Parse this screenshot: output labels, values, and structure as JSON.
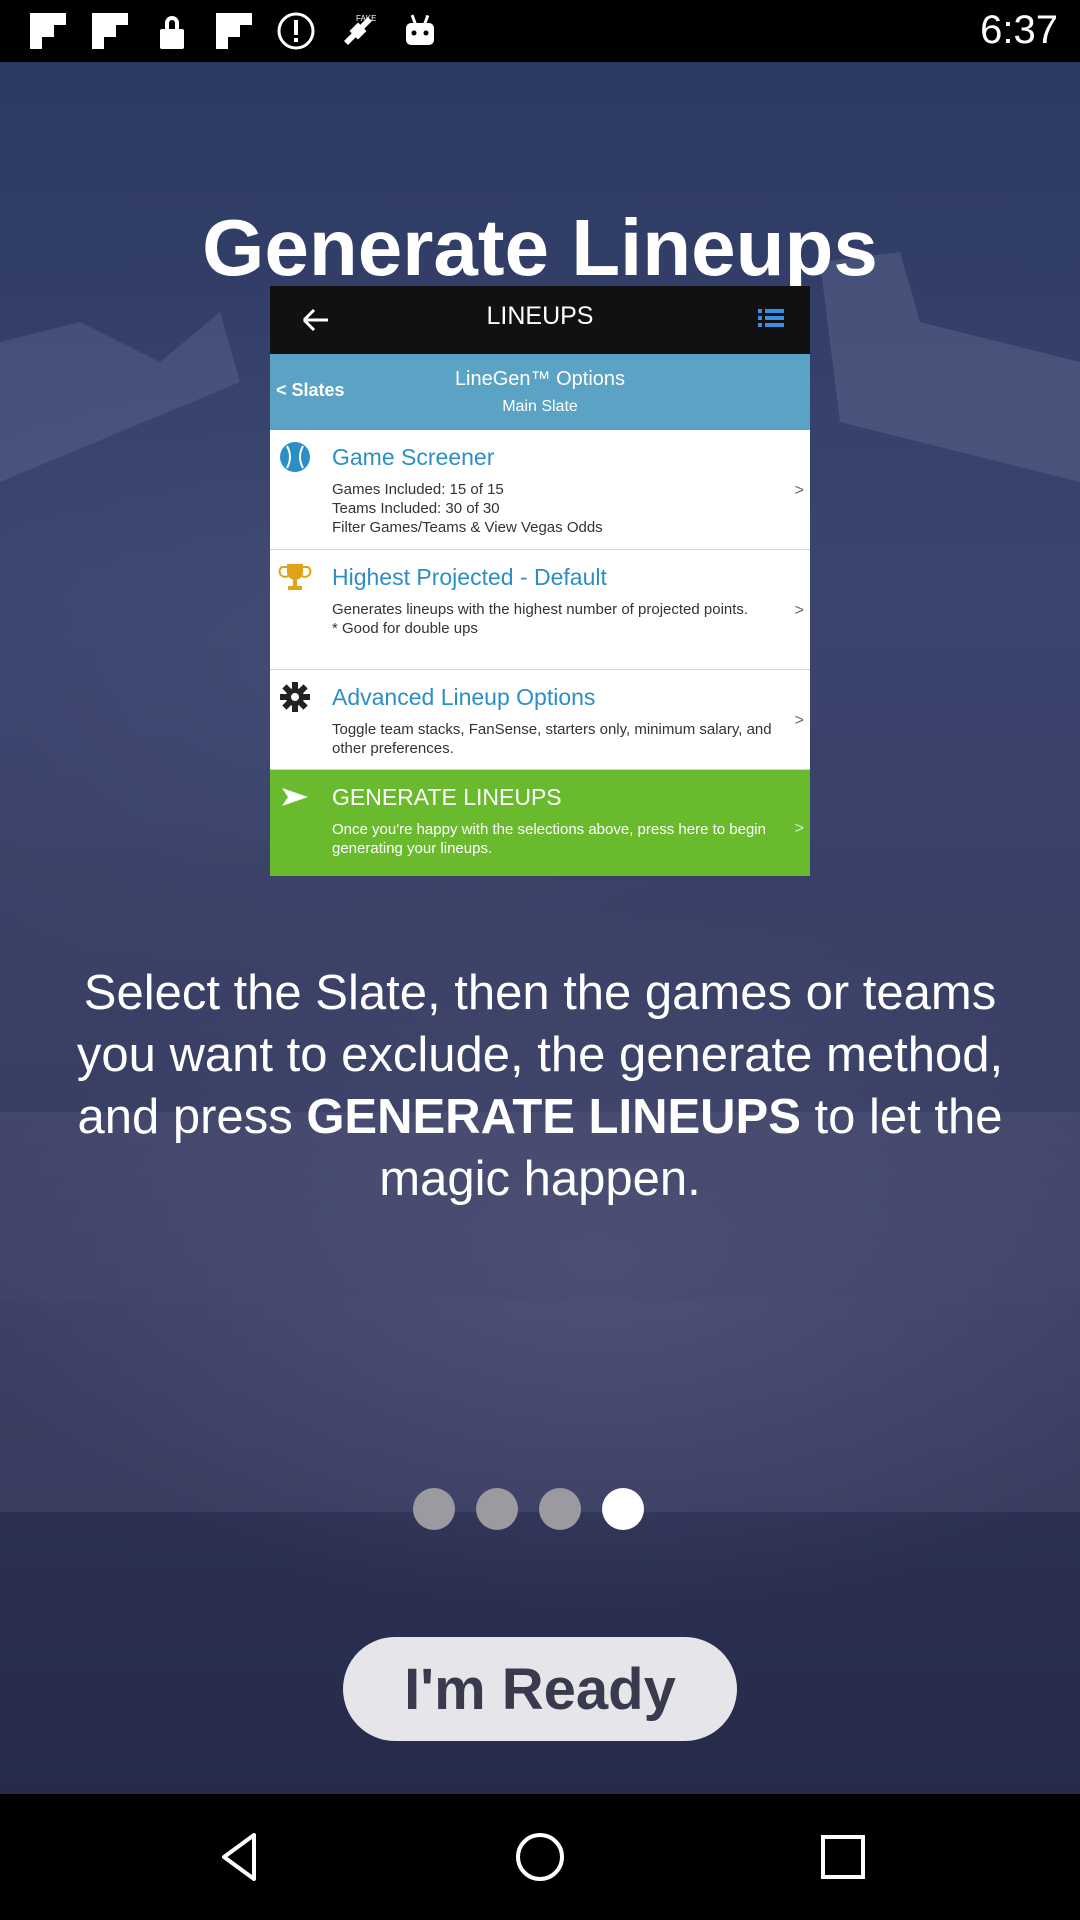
{
  "status_bar": {
    "time": "6:37",
    "icons": [
      "flipboard-icon",
      "flipboard-icon",
      "lock-icon",
      "flipboard-icon",
      "alert-circle-icon",
      "fake-gps-icon",
      "android-icon"
    ]
  },
  "onboarding": {
    "title": "Generate Lineups",
    "screenshot": {
      "topbar_title": "LINEUPS",
      "back_label": "< Slates",
      "options_title": "LineGen™ Options",
      "options_subtitle": "Main Slate",
      "rows": [
        {
          "icon": "baseball-icon",
          "title": "Game Screener",
          "desc": "Games Included: 15 of 15\nTeams Included: 30 of 30\nFilter Games/Teams & View Vegas Odds",
          "chevron": ">"
        },
        {
          "icon": "trophy-icon",
          "title": "Highest Projected - Default",
          "desc": "Generates lineups with the highest number of projected points.\n* Good for double ups",
          "chevron": ">"
        },
        {
          "icon": "gear-icon",
          "title": "Advanced Lineup Options",
          "desc": "Toggle team stacks, FanSense, starters only, minimum salary, and other preferences.",
          "chevron": ">"
        },
        {
          "icon": "send-icon",
          "title": "GENERATE LINEUPS",
          "desc": "Once you're happy with the selections above, press here to begin generating your lineups.",
          "chevron": ">"
        }
      ]
    },
    "description": {
      "part1": "Select the Slate, then the games or teams you want to exclude, the generate method, and press ",
      "bold": "GENERATE LINEUPS",
      "part2": " to let the magic happen."
    },
    "pagination": {
      "total": 4,
      "active_index": 3
    },
    "ready_button": "I'm Ready"
  },
  "colors": {
    "accent_blue": "#2b8fc6",
    "subbar_blue": "#5aa3c4",
    "generate_green": "#6aba2e",
    "button_bg": "#e6e6ea"
  },
  "nav_bar": {
    "icons": [
      "back-icon",
      "home-icon",
      "recents-icon"
    ]
  }
}
